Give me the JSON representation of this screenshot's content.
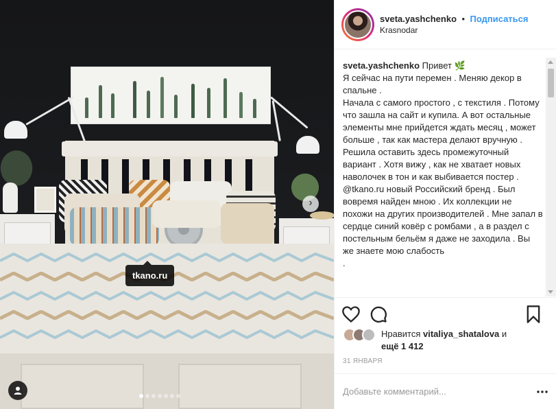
{
  "photo": {
    "tag_label": "tkano.ru",
    "carousel": {
      "total": 7,
      "active_index": 0
    }
  },
  "header": {
    "username": "sveta.yashchenko",
    "separator": "•",
    "follow_label": "Подписаться",
    "location": "Krasnodar"
  },
  "caption": {
    "username": "sveta.yashchenko",
    "lines": [
      "Привет 🌿",
      "Я сейчас на пути перемен . Меняю декор в спальне .",
      "Начала с самого простого , с текстиля . Потому что зашла на сайт и купила. А вот остальные элементы мне прийдется ждать месяц , может больше , так как мастера делают вручную .",
      "Решила оставить здесь промежуточный вариант . Хотя вижу , как не хватает новых наволочек в тон и как выбивается постер .",
      "@tkano.ru новый Российский бренд . Был вовремя найден мною . Их коллекции не похожи на других производителей . Мне запал в сердце синий ковёр с ромбами , а в раздел с постельным бельём я даже не заходила . Вы же знаете мою слабость",
      "."
    ]
  },
  "icons": {
    "like": "heart-icon",
    "comment": "comment-bubble-icon",
    "save": "bookmark-icon",
    "more": "ellipsis-icon",
    "user_tags": "person-icon"
  },
  "likes": {
    "prefix": "Нравится",
    "user": "vitaliya_shatalova",
    "connector": "и",
    "more_label": "ещё 1 412"
  },
  "date": "31 ЯНВАРЯ",
  "add_comment": {
    "placeholder": "Добавьте комментарий..."
  },
  "colors": {
    "accent": "#3897f0",
    "text": "#262626",
    "muted": "#999999"
  }
}
